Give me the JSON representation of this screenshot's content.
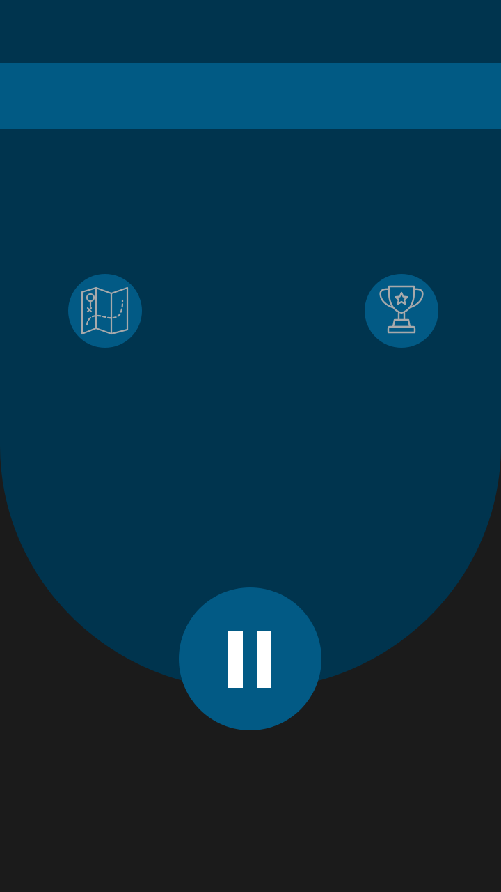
{
  "colors": {
    "background": "#1b1b1b",
    "shield": "#00344e",
    "accent": "#015a84",
    "icon_stroke": "#a7a9ab",
    "pause_glyph": "#ffffff"
  },
  "hud": {
    "map_button": {
      "icon": "map-icon"
    },
    "trophy_button": {
      "icon": "trophy-icon"
    },
    "pause_button": {
      "icon": "pause-icon"
    }
  }
}
